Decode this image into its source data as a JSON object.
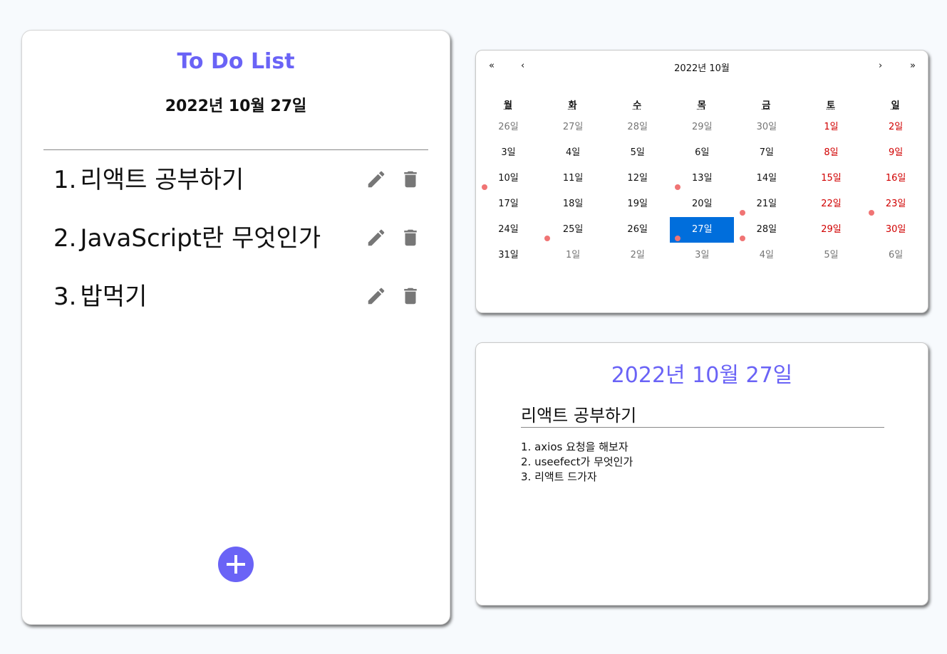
{
  "todo": {
    "title": "To Do List",
    "date": "2022년 10월 27일",
    "items": [
      {
        "num": "1.",
        "text": "리액트 공부하기"
      },
      {
        "num": "2.",
        "text": "JavaScript란 무엇인가"
      },
      {
        "num": "3.",
        "text": "밥먹기"
      }
    ],
    "icons": {
      "edit": "pencil-icon",
      "delete": "trash-icon",
      "add": "plus-icon"
    }
  },
  "calendar": {
    "nav": {
      "prev2": "«",
      "prev": "‹",
      "label": "2022년 10월",
      "next": "›",
      "next2": "»"
    },
    "weekdays": [
      "월",
      "화",
      "수",
      "목",
      "금",
      "토",
      "일"
    ],
    "weeks": [
      [
        "26일",
        "27일",
        "28일",
        "29일",
        "30일",
        "1일",
        "2일"
      ],
      [
        "3일",
        "4일",
        "5일",
        "6일",
        "7일",
        "8일",
        "9일"
      ],
      [
        "10일",
        "11일",
        "12일",
        "13일",
        "14일",
        "15일",
        "16일"
      ],
      [
        "17일",
        "18일",
        "19일",
        "20일",
        "21일",
        "22일",
        "23일"
      ],
      [
        "24일",
        "25일",
        "26일",
        "27일",
        "28일",
        "29일",
        "30일"
      ],
      [
        "31일",
        "1일",
        "2일",
        "3일",
        "4일",
        "5일",
        "6일"
      ]
    ],
    "active": "27일",
    "colors": {
      "active": "#006edc",
      "weekend": "#d10000",
      "dot": "#f07474",
      "accent": "#6a63f6"
    }
  },
  "detail": {
    "date": "2022년 10월 27일",
    "title": "리액트 공부하기",
    "lines": [
      "1. axios 요청을 해보자",
      "2. useefect가 무엇인가",
      "3. 리액트 드가자"
    ]
  }
}
